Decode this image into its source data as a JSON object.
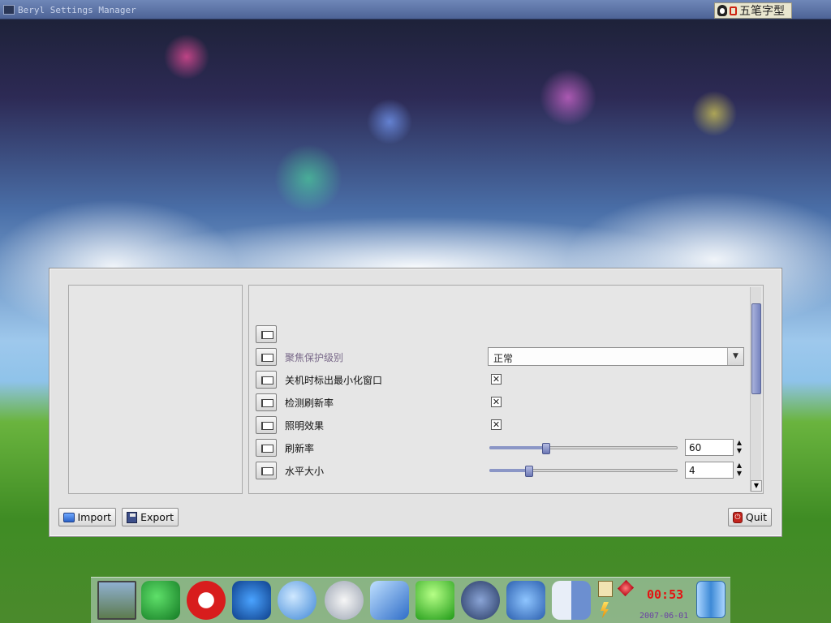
{
  "titlebar": {
    "title": "Beryl Settings Manager",
    "ime_text": "五笔字型"
  },
  "options": {
    "rows": [
      {
        "label": "",
        "control": "none"
      },
      {
        "label": "聚焦保护级别",
        "control": "combo",
        "value": "正常"
      },
      {
        "label": "关机时标出最小化窗口",
        "control": "checkbox",
        "checked": true
      },
      {
        "label": "检测刷新率",
        "control": "checkbox",
        "checked": true
      },
      {
        "label": "照明效果",
        "control": "checkbox",
        "checked": true
      },
      {
        "label": "刷新率",
        "control": "slider",
        "value": "60",
        "fraction": 0.3
      },
      {
        "label": "水平大小",
        "control": "slider",
        "value": "4",
        "fraction": 0.21
      }
    ]
  },
  "buttons": {
    "import_label": "Import",
    "export_label": "Export",
    "quit_label": "Quit"
  },
  "dock": {
    "clock_time": "00:53",
    "clock_date": "2007-06-01",
    "items": [
      "photo",
      "mail",
      "opera",
      "network-browser",
      "chat",
      "mail-client",
      "writer",
      "gem",
      "wolf",
      "network",
      "finder",
      "trash"
    ]
  },
  "colors": {
    "slider_accent": "#8b96c6",
    "clock_red": "#e51212",
    "dim_label": "#7a6a8a"
  }
}
